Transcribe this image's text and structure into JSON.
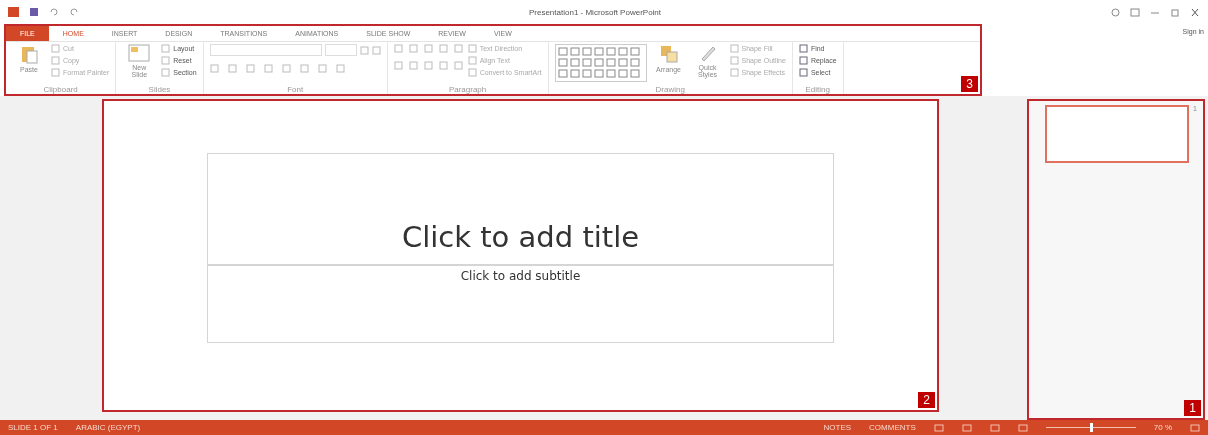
{
  "title_bar": {
    "title": "Presentation1 - Microsoft PowerPoint",
    "sign_in": "Sign in"
  },
  "tabs": [
    {
      "label": "FILE",
      "kind": "file",
      "selected": false
    },
    {
      "label": "HOME",
      "kind": "tab",
      "selected": true
    },
    {
      "label": "INSERT",
      "kind": "tab",
      "selected": false
    },
    {
      "label": "DESIGN",
      "kind": "tab",
      "selected": false
    },
    {
      "label": "TRANSITIONS",
      "kind": "tab",
      "selected": false
    },
    {
      "label": "ANIMATIONS",
      "kind": "tab",
      "selected": false
    },
    {
      "label": "SLIDE SHOW",
      "kind": "tab",
      "selected": false
    },
    {
      "label": "REVIEW",
      "kind": "tab",
      "selected": false
    },
    {
      "label": "VIEW",
      "kind": "tab",
      "selected": false
    }
  ],
  "ribbon": {
    "callout": "3",
    "groups": [
      {
        "label": "Clipboard",
        "kind": "clipboard",
        "large": "Paste",
        "small": [
          "Cut",
          "Copy",
          "Format Painter"
        ]
      },
      {
        "label": "Slides",
        "kind": "slides",
        "large": "New Slide",
        "small": [
          "Layout",
          "Reset",
          "Section"
        ]
      },
      {
        "label": "Font",
        "kind": "font"
      },
      {
        "label": "Paragraph",
        "kind": "paragraph",
        "small": [
          "Text Direction",
          "Align Text",
          "Convert to SmartArt"
        ]
      },
      {
        "label": "Drawing",
        "kind": "drawing",
        "large": "Arrange",
        "second": "Quick Styles",
        "small": [
          "Shape Fill",
          "Shape Outline",
          "Shape Effects"
        ]
      },
      {
        "label": "Editing",
        "kind": "editing",
        "small": [
          "Find",
          "Replace",
          "Select"
        ]
      }
    ]
  },
  "slide": {
    "callout": "2",
    "title_placeholder": "Click to add title",
    "subtitle_placeholder": "Click to add subtitle"
  },
  "thumbnails": {
    "callout": "1",
    "items": [
      {
        "number": "1",
        "selected": true
      }
    ]
  },
  "status_bar": {
    "slide_info": "SLIDE 1 OF 1",
    "language": "ARABIC (EGYPT)",
    "notes": "NOTES",
    "comments": "COMMENTS",
    "zoom": "70 %",
    "zoom_level": {
      "level": 0.5
    }
  }
}
